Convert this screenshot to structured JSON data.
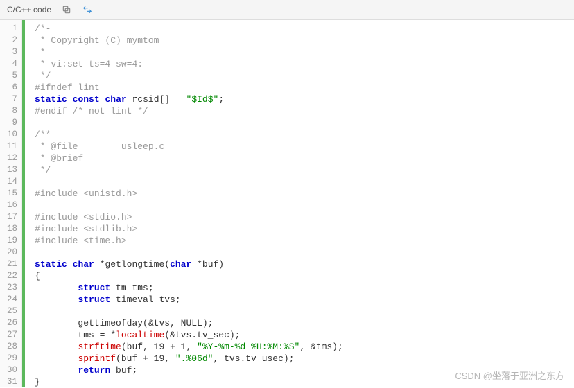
{
  "header": {
    "title": "C/C++ code"
  },
  "watermark": "CSDN @坐落于亚洲之东方",
  "code": {
    "lines": [
      {
        "n": 1,
        "t": [
          {
            "c": "tok-comment",
            "v": "/*-"
          }
        ]
      },
      {
        "n": 2,
        "t": [
          {
            "c": "tok-comment",
            "v": " * Copyright (C) mymtom"
          }
        ]
      },
      {
        "n": 3,
        "t": [
          {
            "c": "tok-comment",
            "v": " *"
          }
        ]
      },
      {
        "n": 4,
        "t": [
          {
            "c": "tok-comment",
            "v": " * vi:set ts=4 sw=4:"
          }
        ]
      },
      {
        "n": 5,
        "t": [
          {
            "c": "tok-comment",
            "v": " */"
          }
        ]
      },
      {
        "n": 6,
        "t": [
          {
            "c": "tok-pre",
            "v": "#ifndef lint"
          }
        ]
      },
      {
        "n": 7,
        "t": [
          {
            "c": "tok-kw",
            "v": "static"
          },
          {
            "c": "tok-plain",
            "v": " "
          },
          {
            "c": "tok-kw",
            "v": "const"
          },
          {
            "c": "tok-plain",
            "v": " "
          },
          {
            "c": "tok-type",
            "v": "char"
          },
          {
            "c": "tok-plain",
            "v": " rcsid[] = "
          },
          {
            "c": "tok-str",
            "v": "\"$Id$\""
          },
          {
            "c": "tok-plain",
            "v": ";"
          }
        ]
      },
      {
        "n": 8,
        "t": [
          {
            "c": "tok-pre",
            "v": "#endif "
          },
          {
            "c": "tok-comment",
            "v": "/* not lint */"
          }
        ]
      },
      {
        "n": 9,
        "t": []
      },
      {
        "n": 10,
        "t": [
          {
            "c": "tok-comment",
            "v": "/**"
          }
        ]
      },
      {
        "n": 11,
        "t": [
          {
            "c": "tok-comment",
            "v": " * @file        usleep.c"
          }
        ]
      },
      {
        "n": 12,
        "t": [
          {
            "c": "tok-comment",
            "v": " * @brief"
          }
        ]
      },
      {
        "n": 13,
        "t": [
          {
            "c": "tok-comment",
            "v": " */"
          }
        ]
      },
      {
        "n": 14,
        "t": []
      },
      {
        "n": 15,
        "t": [
          {
            "c": "tok-pre",
            "v": "#include <unistd.h>"
          }
        ]
      },
      {
        "n": 16,
        "t": []
      },
      {
        "n": 17,
        "t": [
          {
            "c": "tok-pre",
            "v": "#include <stdio.h>"
          }
        ]
      },
      {
        "n": 18,
        "t": [
          {
            "c": "tok-pre",
            "v": "#include <stdlib.h>"
          }
        ]
      },
      {
        "n": 19,
        "t": [
          {
            "c": "tok-pre",
            "v": "#include <time.h>"
          }
        ]
      },
      {
        "n": 20,
        "t": []
      },
      {
        "n": 21,
        "t": [
          {
            "c": "tok-kw",
            "v": "static"
          },
          {
            "c": "tok-plain",
            "v": " "
          },
          {
            "c": "tok-type",
            "v": "char"
          },
          {
            "c": "tok-plain",
            "v": " *getlongtime("
          },
          {
            "c": "tok-type",
            "v": "char"
          },
          {
            "c": "tok-plain",
            "v": " *buf)"
          }
        ]
      },
      {
        "n": 22,
        "t": [
          {
            "c": "tok-plain",
            "v": "{"
          }
        ]
      },
      {
        "n": 23,
        "t": [
          {
            "c": "tok-plain",
            "v": "        "
          },
          {
            "c": "tok-kw",
            "v": "struct"
          },
          {
            "c": "tok-plain",
            "v": " tm tms;"
          }
        ]
      },
      {
        "n": 24,
        "t": [
          {
            "c": "tok-plain",
            "v": "        "
          },
          {
            "c": "tok-kw",
            "v": "struct"
          },
          {
            "c": "tok-plain",
            "v": " timeval tvs;"
          }
        ]
      },
      {
        "n": 25,
        "t": []
      },
      {
        "n": 26,
        "t": [
          {
            "c": "tok-plain",
            "v": "        gettimeofday(&tvs, NULL);"
          }
        ]
      },
      {
        "n": 27,
        "t": [
          {
            "c": "tok-plain",
            "v": "        tms = *"
          },
          {
            "c": "tok-fn",
            "v": "localtime"
          },
          {
            "c": "tok-plain",
            "v": "(&tvs.tv_sec);"
          }
        ]
      },
      {
        "n": 28,
        "t": [
          {
            "c": "tok-plain",
            "v": "        "
          },
          {
            "c": "tok-fn",
            "v": "strftime"
          },
          {
            "c": "tok-plain",
            "v": "(buf, 19 + 1, "
          },
          {
            "c": "tok-str",
            "v": "\"%Y-%m-%d %H:%M:%S\""
          },
          {
            "c": "tok-plain",
            "v": ", &tms);"
          }
        ]
      },
      {
        "n": 29,
        "t": [
          {
            "c": "tok-plain",
            "v": "        "
          },
          {
            "c": "tok-fn",
            "v": "sprintf"
          },
          {
            "c": "tok-plain",
            "v": "(buf + 19, "
          },
          {
            "c": "tok-str",
            "v": "\".%06d\""
          },
          {
            "c": "tok-plain",
            "v": ", tvs.tv_usec);"
          }
        ]
      },
      {
        "n": 30,
        "t": [
          {
            "c": "tok-plain",
            "v": "        "
          },
          {
            "c": "tok-kw",
            "v": "return"
          },
          {
            "c": "tok-plain",
            "v": " buf;"
          }
        ]
      },
      {
        "n": 31,
        "t": [
          {
            "c": "tok-plain",
            "v": "}"
          }
        ]
      }
    ]
  }
}
